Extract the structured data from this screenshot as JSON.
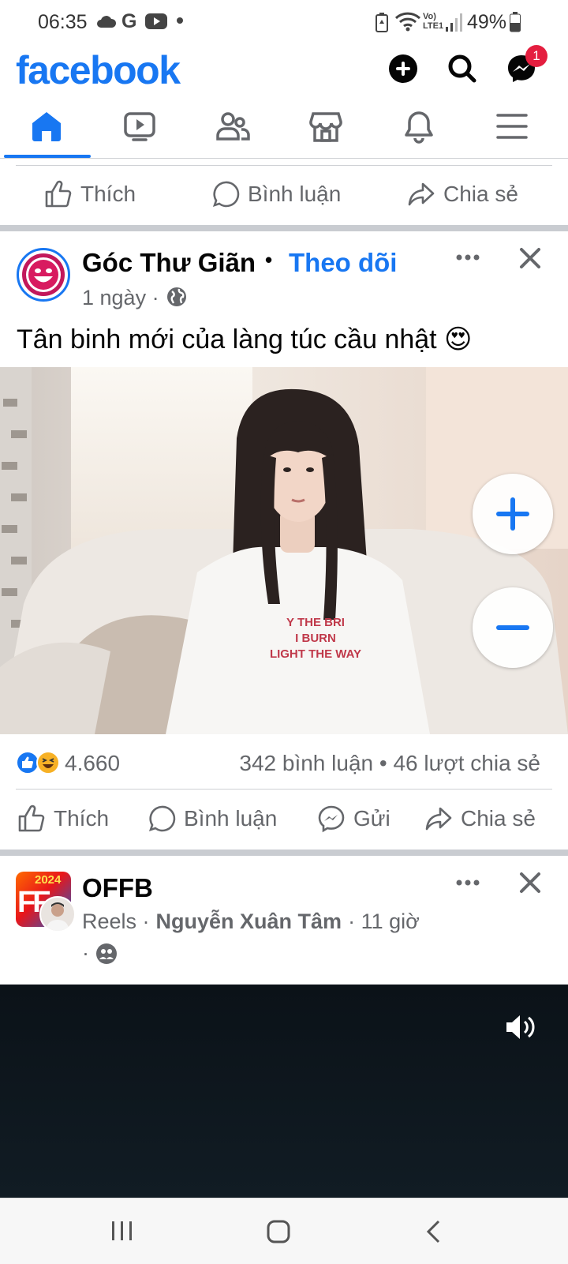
{
  "status_bar": {
    "time": "06:35",
    "battery": "49%",
    "left_icons": [
      "cloud-icon",
      "google-icon",
      "youtube-icon",
      "dot-icon"
    ],
    "right_icons": [
      "battery-saver-icon",
      "wifi-icon",
      "volte-icon",
      "signal-icon",
      "battery-icon"
    ]
  },
  "header": {
    "logo": "facebook",
    "messenger_badge": "1",
    "buttons": [
      "create-post-button",
      "search-button",
      "messenger-button"
    ]
  },
  "tabs": [
    "home",
    "video",
    "friends",
    "marketplace",
    "notifications",
    "menu"
  ],
  "top_actions": {
    "like": "Thích",
    "comment": "Bình luận",
    "share": "Chia sẻ"
  },
  "post1": {
    "page_name": "Góc Thư Giãn",
    "separator": "•",
    "follow": "Theo dõi",
    "time": "1 ngày ·",
    "caption": "Tân binh mới của làng túc cầu nhật 😍",
    "shirt_text": [
      "Y THE BRI",
      "I BURN",
      "LIGHT THE WAY"
    ],
    "reactions_count": "4.660",
    "comments_shares": "342 bình luận • 46 lượt chia sẻ",
    "actions": {
      "like": "Thích",
      "comment": "Bình luận",
      "send": "Gửi",
      "share": "Chia sẻ"
    }
  },
  "post2": {
    "page_name": "OFFB",
    "avatar_text": "2024",
    "reels": "Reels ·",
    "author": "Nguyễn Xuân Tâm",
    "time": "· 11 giờ",
    "audience_sep": "·"
  },
  "colors": {
    "brand": "#1877f2",
    "text": "#050505",
    "secondary_text": "#65676b",
    "badge": "#e41e3f"
  }
}
